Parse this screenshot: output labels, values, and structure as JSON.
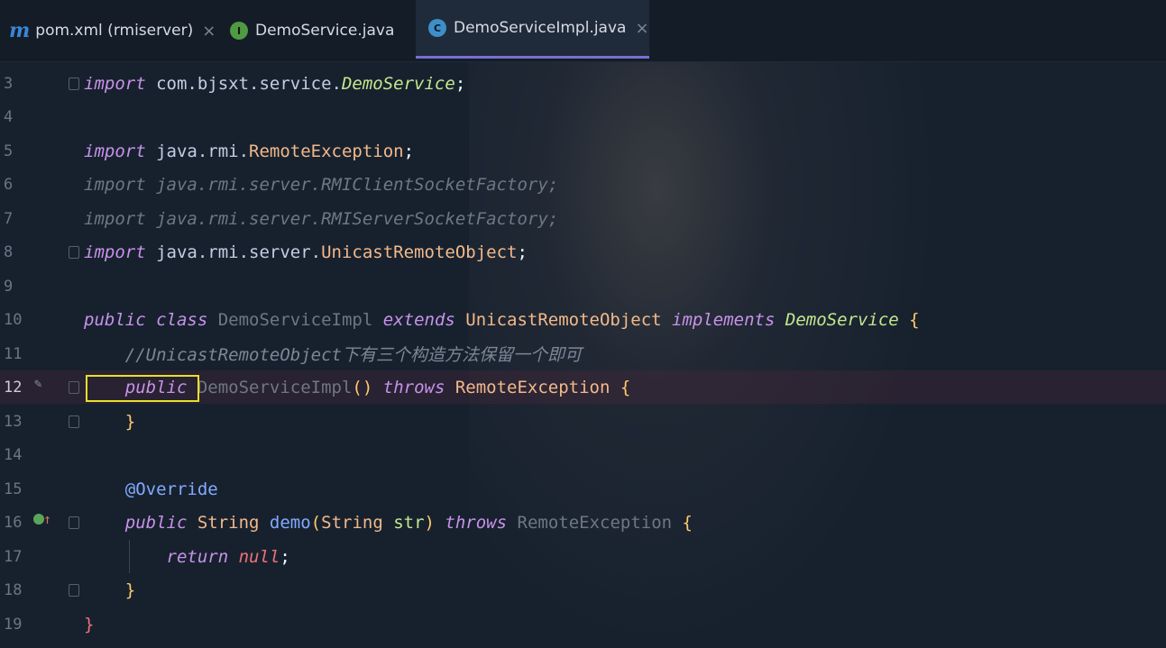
{
  "tabs": [
    {
      "label": "pom.xml (rmiserver)",
      "icon": "m"
    },
    {
      "label": "DemoService.java",
      "icon": "I"
    },
    {
      "label": "DemoServiceImpl.java",
      "icon": "C"
    }
  ],
  "close_glyph": "×",
  "lines": {
    "l3": {
      "num": "3",
      "t1": "import",
      "t2": " com.bjsxt.service.",
      "t3": "DemoService",
      "t4": ";"
    },
    "l4": {
      "num": "4"
    },
    "l5": {
      "num": "5",
      "t1": "import",
      "t2": " java.rmi.",
      "t3": "RemoteException",
      "t4": ";"
    },
    "l6": {
      "num": "6",
      "t1": "import java.rmi.server.",
      "t2": "RMIClientSocketFactory",
      "t3": ";"
    },
    "l7": {
      "num": "7",
      "t1": "import java.rmi.server.",
      "t2": "RMIServerSocketFactory",
      "t3": ";"
    },
    "l8": {
      "num": "8",
      "t1": "import",
      "t2": " java.rmi.server.",
      "t3": "UnicastRemoteObject",
      "t4": ";"
    },
    "l9": {
      "num": "9"
    },
    "l10": {
      "num": "10",
      "t1": "public class",
      "t2": " DemoServiceImpl ",
      "t3": "extends",
      "t4": " UnicastRemoteObject ",
      "t5": "implements",
      "t6": " DemoService",
      "t7": " {"
    },
    "l11": {
      "num": "11",
      "t1": "    //UnicastRemoteObject下有三个构造方法保留一个即可"
    },
    "l12": {
      "num": "12",
      "t1": "    public",
      "t2": " DemoServiceImpl",
      "t3": "()",
      "t4": " throws",
      "t5": " RemoteException",
      "t6": " {"
    },
    "l13": {
      "num": "13",
      "t1": "    }"
    },
    "l14": {
      "num": "14"
    },
    "l15": {
      "num": "15",
      "t1": "    @Override"
    },
    "l16": {
      "num": "16",
      "t1": "    public",
      "t2": " String",
      "t3": " demo",
      "t4": "(",
      "t5": "String",
      "t6": " str",
      "t7": ")",
      "t8": " throws",
      "t9": " RemoteException",
      "t10": " {"
    },
    "l17": {
      "num": "17",
      "t1": "        return",
      "t2": " null",
      "t3": ";"
    },
    "l18": {
      "num": "18",
      "t1": "    }"
    },
    "l19": {
      "num": "19",
      "t1": "}"
    }
  },
  "gutter_icons": {
    "override": "override-up-icon",
    "edit": "edit-pencil-icon"
  },
  "colors": {
    "highlight_box": "#e8e029",
    "active_tab_underline": "#7a6fd1"
  }
}
